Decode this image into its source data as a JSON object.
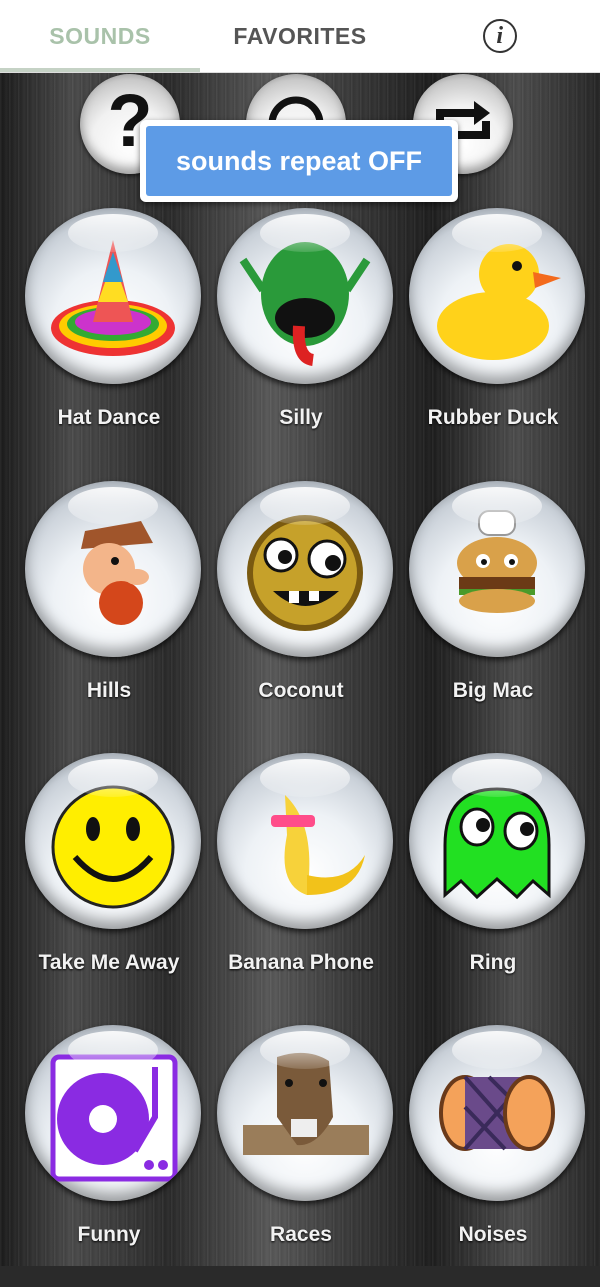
{
  "tabs": {
    "sounds": "SOUNDS",
    "favorites": "FAVORITES",
    "info_icon": "info-icon"
  },
  "controls": {
    "help_icon": "question-icon",
    "help_glyph": "?",
    "stop_icon": "stop-icon",
    "repeat_icon": "repeat-icon"
  },
  "toast": {
    "message": "sounds repeat OFF"
  },
  "sounds": [
    {
      "label": "Hat Dance",
      "icon": "sombrero-icon"
    },
    {
      "label": "Silly",
      "icon": "silly-monster-icon"
    },
    {
      "label": "Rubber Duck",
      "icon": "rubber-duck-icon"
    },
    {
      "label": "Hills",
      "icon": "hillbilly-icon"
    },
    {
      "label": "Coconut",
      "icon": "coconut-face-icon"
    },
    {
      "label": "Big Mac",
      "icon": "burger-chef-icon"
    },
    {
      "label": "Take Me Away",
      "icon": "smiley-face-icon"
    },
    {
      "label": "Banana Phone",
      "icon": "banana-icon"
    },
    {
      "label": "Ring",
      "icon": "green-ghost-icon"
    },
    {
      "label": "Funny",
      "icon": "turntable-icon"
    },
    {
      "label": "Races",
      "icon": "horse-icon"
    },
    {
      "label": "Noises",
      "icon": "drum-icon"
    }
  ],
  "colors": {
    "tab_active": "#a9c2aa",
    "tab_inactive": "#555555",
    "toast_bg": "#5d9be6"
  }
}
